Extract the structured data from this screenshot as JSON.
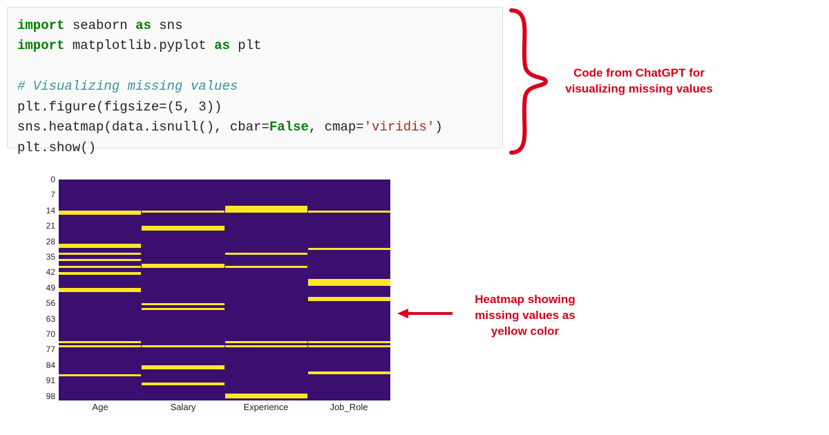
{
  "code": {
    "l1_import": "import",
    "l1_seaborn": "seaborn",
    "l1_as": "as",
    "l1_sns": "sns",
    "l2_import": "import",
    "l2_mpl": "matplotlib.pyplot",
    "l2_as": "as",
    "l2_plt": "plt",
    "l3_comment": "# Visualizing missing values",
    "l4": "plt.figure(figsize=(5, 3))",
    "l5_a": "sns.heatmap(data.isnull(), cbar=",
    "l5_false": "False",
    "l5_b": ", cmap=",
    "l5_str": "'viridis'",
    "l5_c": ")",
    "l6": "plt.show()"
  },
  "annotations": {
    "code_label": "Code from ChatGPT for visualizing missing values",
    "heatmap_label": "Heatmap showing missing values as yellow color"
  },
  "chart_data": {
    "type": "heatmap",
    "title": "",
    "xlabel": "",
    "ylabel": "",
    "x_categories": [
      "Age",
      "Salary",
      "Experience",
      "Job_Role"
    ],
    "y_ticks": [
      0,
      7,
      14,
      21,
      28,
      35,
      42,
      49,
      56,
      63,
      70,
      77,
      84,
      91,
      98
    ],
    "y_range": [
      0,
      100
    ],
    "colormap": "viridis",
    "legend": false,
    "note": "Yellow cells indicate missing (null) values; dark purple indicates present values.",
    "missing_rows_by_column": {
      "Age": [
        14,
        15,
        29,
        30,
        33,
        36,
        39,
        42,
        49,
        50,
        73,
        75,
        88
      ],
      "Salary": [
        14,
        21,
        22,
        38,
        39,
        56,
        58,
        75,
        84,
        85,
        92
      ],
      "Experience": [
        12,
        13,
        14,
        33,
        39,
        73,
        75,
        97,
        98
      ],
      "Job_Role": [
        14,
        31,
        45,
        46,
        47,
        53,
        54,
        73,
        75,
        87
      ]
    }
  }
}
